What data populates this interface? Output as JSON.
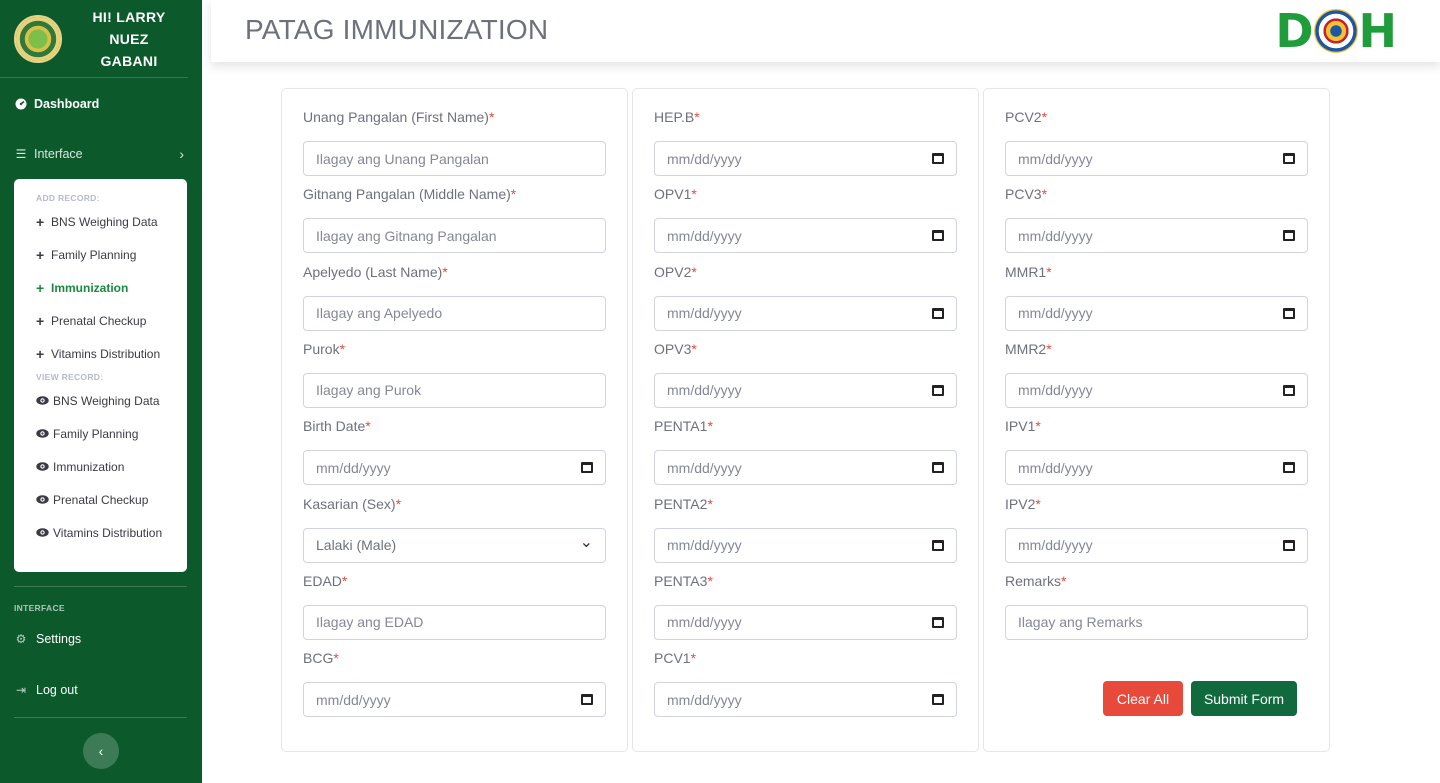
{
  "sidebar": {
    "greeting_lines": [
      "HI! LARRY",
      "NUEZ",
      "GABANI"
    ],
    "dashboard": "Dashboard",
    "interface": "Interface",
    "add_heading": "ADD RECORD:",
    "add_items": [
      "BNS Weighing Data",
      "Family Planning",
      "Immunization",
      "Prenatal Checkup",
      "Vitamins Distribution"
    ],
    "view_heading": "VIEW RECORD:",
    "view_items": [
      "BNS Weighing Data",
      "Family Planning",
      "Immunization",
      "Prenatal Checkup",
      "Vitamins Distribution"
    ],
    "interface_heading": "INTERFACE",
    "settings": "Settings",
    "logout": "Log out",
    "toggle": "‹"
  },
  "header": {
    "title": "PATAG IMMUNIZATION",
    "logo_text": [
      "D",
      "H"
    ]
  },
  "form": {
    "col1": [
      {
        "label": "Unang Pangalan (First Name)",
        "placeholder": "Ilagay ang Unang Pangalan"
      },
      {
        "label": "Gitnang Pangalan (Middle Name)",
        "placeholder": "Ilagay ang Gitnang Pangalan"
      },
      {
        "label": "Apelyedo (Last Name)",
        "placeholder": "Ilagay ang Apelyedo"
      },
      {
        "label": "Purok",
        "placeholder": "Ilagay ang Purok"
      },
      {
        "label": "Birth Date",
        "placeholder": "mm/dd/yyyy"
      },
      {
        "label": "Kasarian (Sex)",
        "value": "Lalaki (Male)"
      },
      {
        "label": "EDAD",
        "placeholder": "Ilagay ang EDAD"
      },
      {
        "label": "BCG",
        "placeholder": "mm/dd/yyyy"
      }
    ],
    "col2": [
      {
        "label": "HEP.B",
        "placeholder": "mm/dd/yyyy"
      },
      {
        "label": "OPV1",
        "placeholder": "mm/dd/yyyy"
      },
      {
        "label": "OPV2",
        "placeholder": "mm/dd/yyyy"
      },
      {
        "label": "OPV3",
        "placeholder": "mm/dd/yyyy"
      },
      {
        "label": "PENTA1",
        "placeholder": "mm/dd/yyyy"
      },
      {
        "label": "PENTA2",
        "placeholder": "mm/dd/yyyy"
      },
      {
        "label": "PENTA3",
        "placeholder": "mm/dd/yyyy"
      },
      {
        "label": "PCV1",
        "placeholder": "mm/dd/yyyy"
      }
    ],
    "col3": [
      {
        "label": "PCV2",
        "placeholder": "mm/dd/yyyy"
      },
      {
        "label": "PCV3",
        "placeholder": "mm/dd/yyyy"
      },
      {
        "label": "MMR1",
        "placeholder": "mm/dd/yyyy"
      },
      {
        "label": "MMR2",
        "placeholder": "mm/dd/yyyy"
      },
      {
        "label": "IPV1",
        "placeholder": "mm/dd/yyyy"
      },
      {
        "label": "IPV2",
        "placeholder": "mm/dd/yyyy"
      },
      {
        "label": "Remarks",
        "placeholder": "Ilagay ang Remarks"
      }
    ],
    "required_mark": "*",
    "clear_label": "Clear All",
    "submit_label": "Submit Form"
  },
  "colors": {
    "sidebar_bg": "#0c5a2c",
    "accent_green": "#1f9d3b",
    "active_item": "#1a8a3f",
    "clear_button": "#e74a3b",
    "submit_button": "#116a3d"
  },
  "icons": {
    "dashboard": "tachometer-icon",
    "interface": "list-icon",
    "settings": "gear-icon",
    "logout": "sign-out-icon",
    "add": "plus-icon",
    "view": "eye-icon",
    "date": "calendar-icon",
    "select": "chevron-down-icon"
  }
}
